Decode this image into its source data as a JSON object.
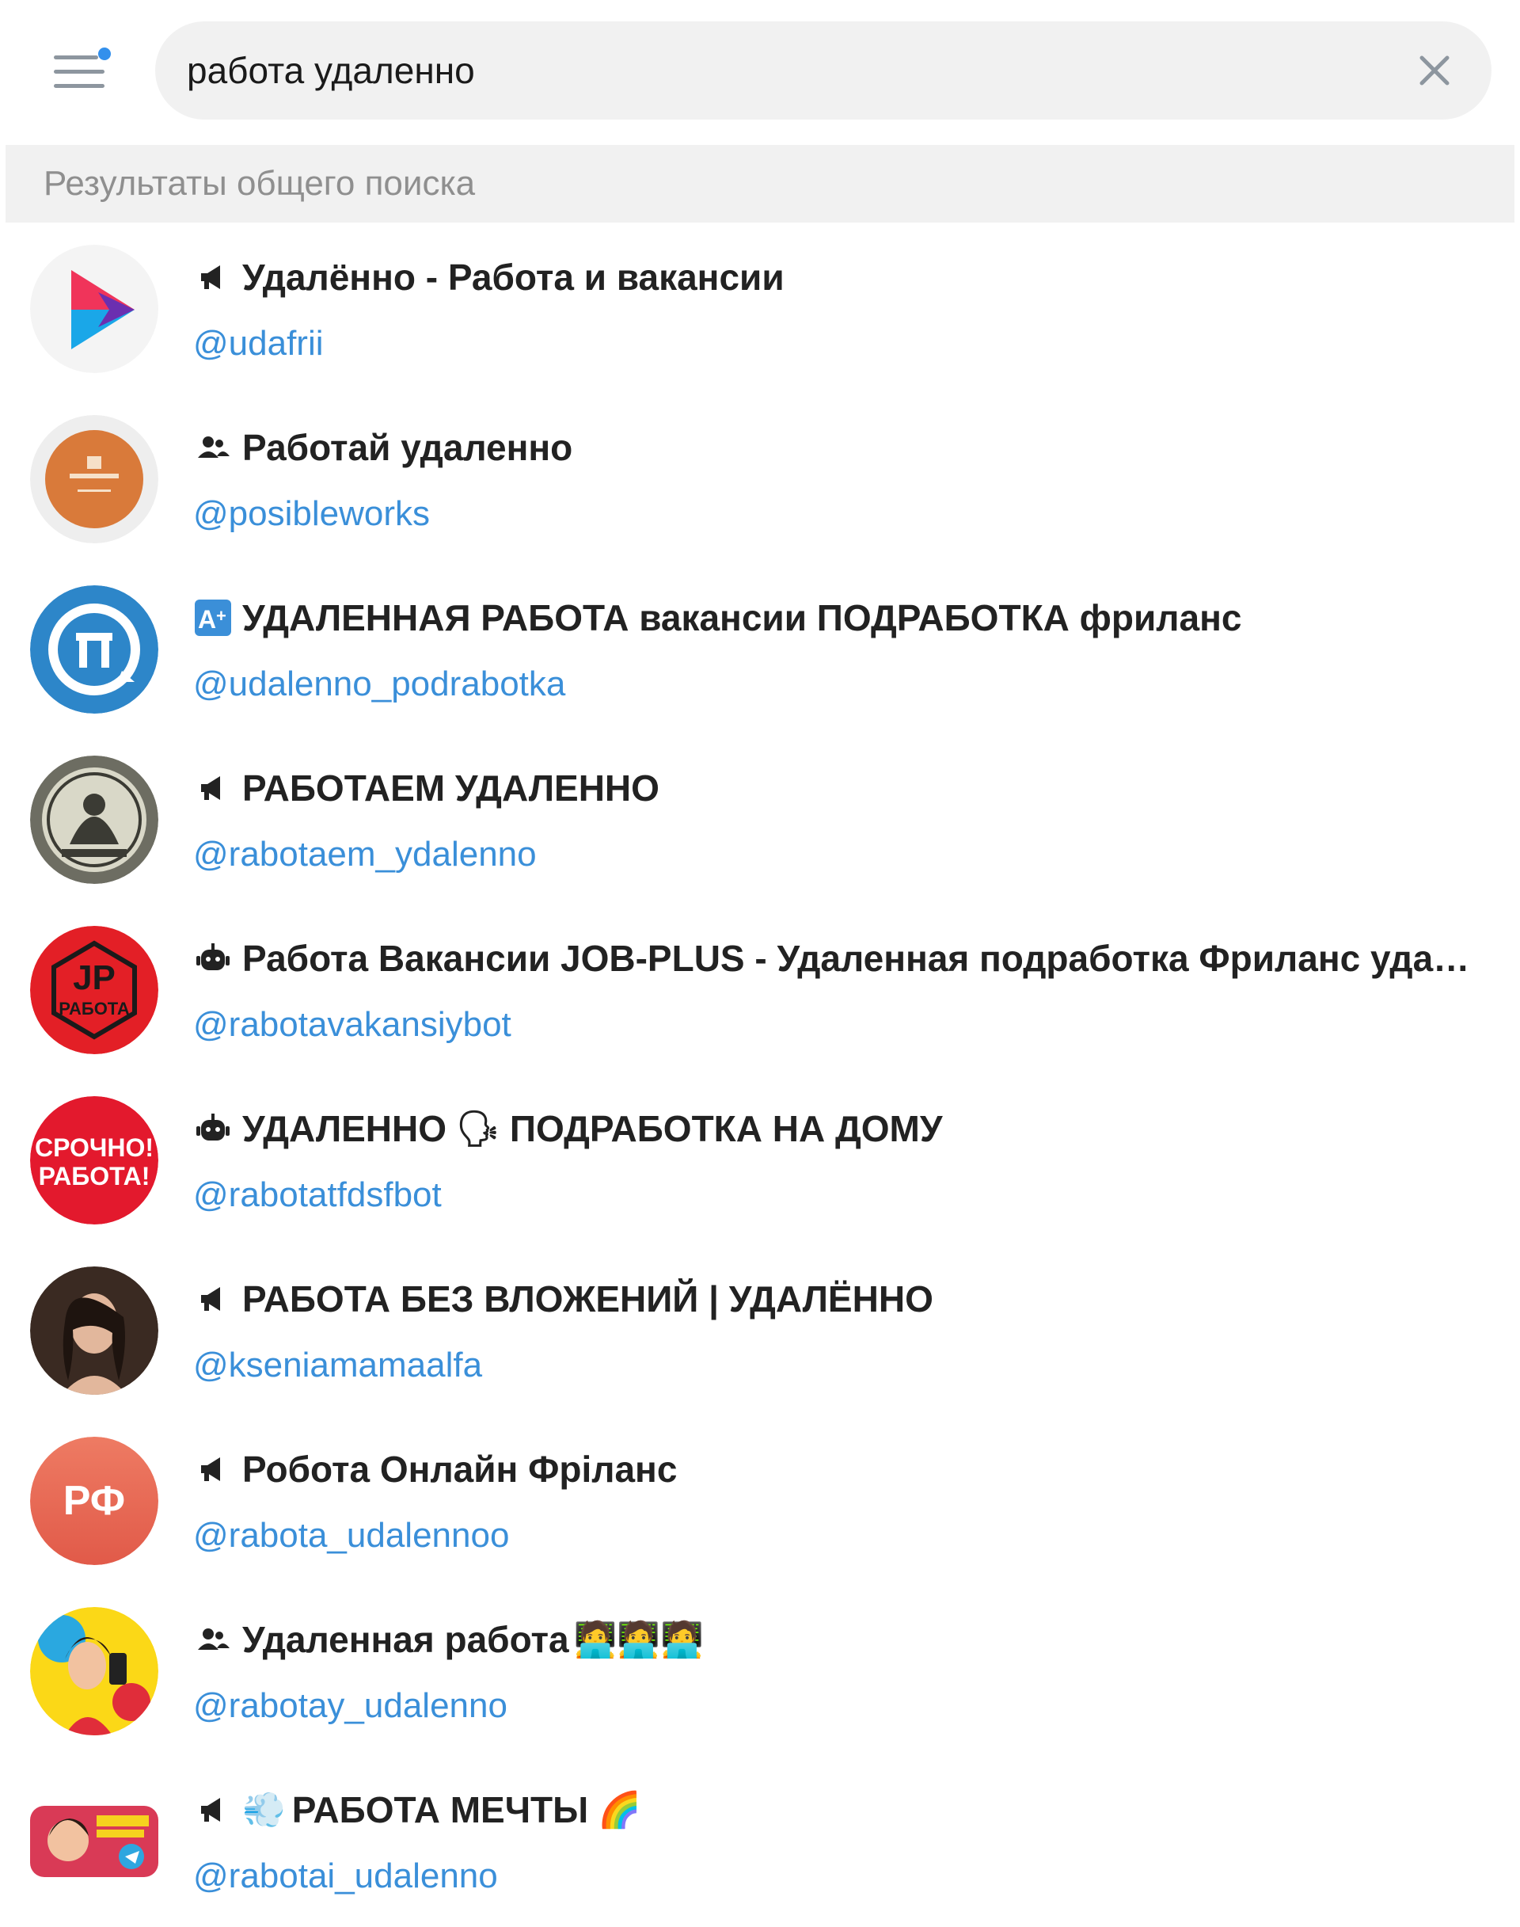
{
  "search": {
    "query": "работа удаленно"
  },
  "section": {
    "title": "Результаты общего поиска"
  },
  "colors": {
    "accent": "#3390ec",
    "username": "#3a8fd9",
    "muted_text": "#8f8f8f",
    "panel_bg": "#f1f1f1"
  },
  "results": [
    {
      "type_icon": "channel-megaphone-icon",
      "title": "Удалённо - Работа и вакансии",
      "username": "@udafrii",
      "avatar": "play-logo"
    },
    {
      "type_icon": "group-people-icon",
      "title": "Работай удаленно",
      "username": "@posibleworks",
      "avatar": "orange-badge"
    },
    {
      "type_icon": "a-plus-badge-icon",
      "title": "УДАЛЕННАЯ РАБОТА вакансии ПОДРАБОТКА фриланс",
      "username": "@udalenno_podrabotka",
      "avatar": "blue-p-logo"
    },
    {
      "type_icon": "channel-megaphone-icon",
      "title": "РАБОТАЕМ УДАЛЕННО",
      "username": "@rabotaem_ydalenno",
      "avatar": "gray-emblem"
    },
    {
      "type_icon": "bot-icon",
      "title": "Работа Вакансии JOB-PLUS - Удаленная подработка Фриланс удален...",
      "username": "@rabotavakansiybot",
      "avatar": "jp-logo",
      "avatar_text": [
        "JP",
        "РАБОТА"
      ]
    },
    {
      "type_icon": "bot-icon",
      "title": "УДАЛЕННО",
      "title_emoji": "🗣",
      "title_tail": "ПОДРАБОТКА НА ДОМУ",
      "username": "@rabotatfdsfbot",
      "avatar": "urgent-logo",
      "avatar_text": [
        "СРОЧНО!",
        "РАБОТА!"
      ]
    },
    {
      "type_icon": "channel-megaphone-icon",
      "title": "РАБОТА БЕЗ ВЛОЖЕНИЙ | УДАЛЁННО",
      "username": "@kseniamamaalfa",
      "avatar": "portrait"
    },
    {
      "type_icon": "channel-megaphone-icon",
      "title": "Робота Онлайн Фріланс",
      "username": "@rabota_udalennoo",
      "avatar": "initials",
      "avatar_text": [
        "РФ"
      ]
    },
    {
      "type_icon": "group-people-icon",
      "title": "Удаленная работа",
      "title_emoji": "🧑‍💻🧑‍💻🧑‍💻",
      "username": "@rabotay_udalenno",
      "avatar": "cartoon-woman"
    },
    {
      "type_icon": "channel-megaphone-icon",
      "title_prefix_emoji": "💨",
      "title": "РАБОТА МЕЧТЫ",
      "title_emoji": "🌈",
      "username": "@rabotai_udalenno",
      "avatar": "telegram-banner"
    }
  ]
}
